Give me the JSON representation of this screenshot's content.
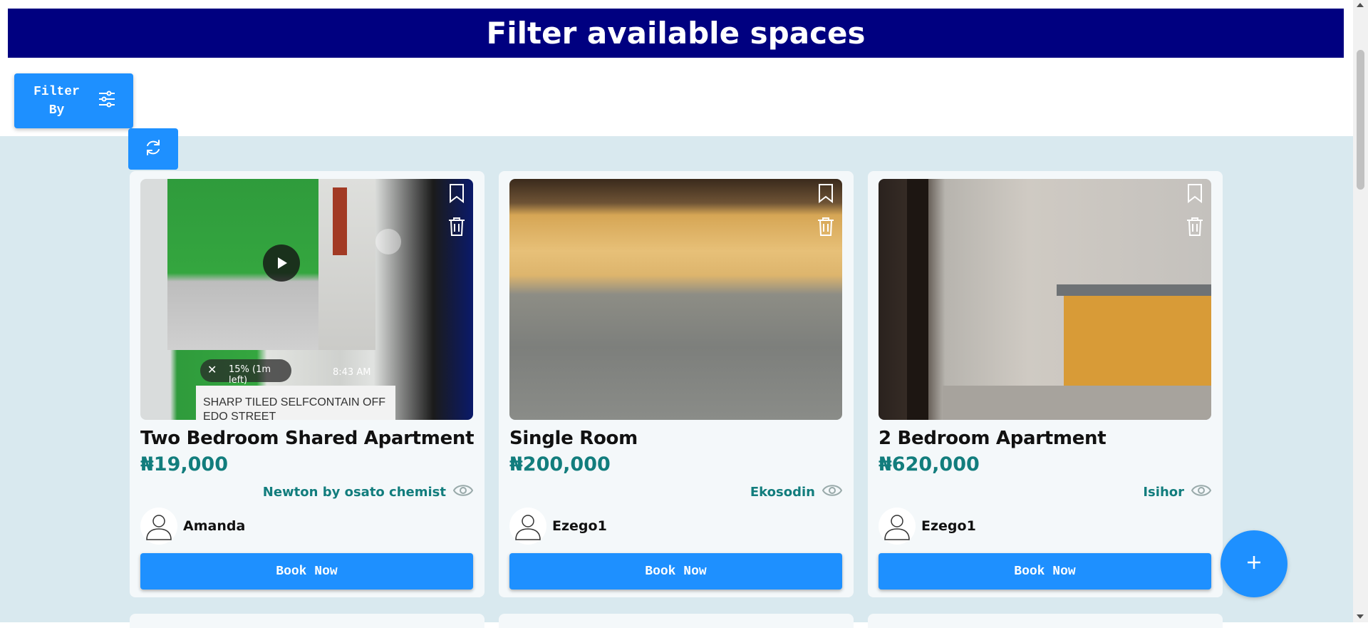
{
  "header": {
    "title": "Filter available spaces"
  },
  "filter": {
    "label": "Filter By"
  },
  "cards": [
    {
      "title": "Two Bedroom Shared Apartment",
      "price": "₦19,000",
      "location": "Newton by osato chemist",
      "user": "Amanda",
      "book_label": "Book Now",
      "overlay": {
        "progress": "15% (1m left)",
        "time": "8:43 AM",
        "caption": "SHARP TILED SELFCONTAIN OFF EDO STREET"
      }
    },
    {
      "title": "Single Room",
      "price": "₦200,000",
      "location": "Ekosodin",
      "user": "Ezego1",
      "book_label": "Book Now"
    },
    {
      "title": "2 Bedroom Apartment",
      "price": "₦620,000",
      "location": "Isihor",
      "user": "Ezego1",
      "book_label": "Book Now"
    }
  ],
  "colors": {
    "header_bg": "#000080",
    "accent": "#1e90ff",
    "price": "#127d7d",
    "page_bg": "#d9e9ef"
  }
}
